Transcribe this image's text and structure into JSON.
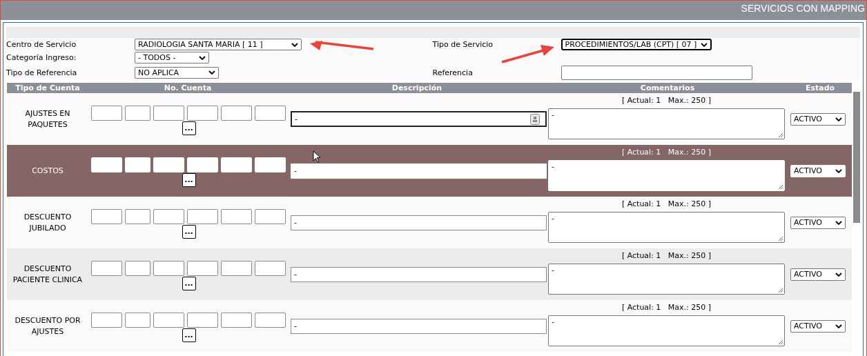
{
  "header": {
    "title": "SERVICIOS CON MAPPING"
  },
  "form_rows": [
    {
      "left": {
        "label": "Centro de Servicio",
        "kind": "select",
        "value": "RADIOLOGIA SANTA MARIA [ 11 ]",
        "focused": false
      },
      "right": {
        "label": "Tipo de Servicio",
        "kind": "select",
        "value": "PROCEDIMIENTOS/LAB (CPT) [ 07 ]",
        "focused": true
      }
    },
    {
      "left": {
        "label": "Categoría Ingreso:",
        "kind": "select",
        "value": "- TODOS -",
        "focused": false
      }
    },
    {
      "left": {
        "label": "Tipo de Referencia",
        "kind": "select",
        "value": "NO APLICA",
        "focused": false
      },
      "right": {
        "label": "Referencia",
        "kind": "input",
        "focused": false
      }
    }
  ],
  "table": {
    "columns": [
      "Tipo de Cuenta",
      "No. Cuenta",
      "Descripción",
      "Comentarios",
      "Estado"
    ],
    "lookup_button": "...",
    "rows": [
      {
        "account_type": "AJUSTES EN PAQUETES",
        "description": "-",
        "counter": "[ Actual: 1   Max.: 250 ]",
        "comment": "-",
        "status": "ACTIVO",
        "selected": false,
        "focused": true
      },
      {
        "account_type": "COSTOS",
        "description": "-",
        "counter": "[ Actual: 1   Max.: 250 ]",
        "comment": "-",
        "status": "ACTIVO",
        "selected": true,
        "focused": false
      },
      {
        "account_type": "DESCUENTO JUBILADO",
        "description": "-",
        "counter": "[ Actual: 1   Max.: 250 ]",
        "comment": "-",
        "status": "ACTIVO",
        "selected": false,
        "focused": false
      },
      {
        "account_type": "DESCUENTO PACIENTE CLINICA",
        "description": "-",
        "counter": "[ Actual: 1   Max.: 250 ]",
        "comment": "-",
        "status": "ACTIVO",
        "selected": false,
        "focused": false
      },
      {
        "account_type": "DESCUENTO POR AJUSTES",
        "description": "-",
        "counter": "[ Actual: 1   Max.: 250 ]",
        "comment": "-",
        "status": "ACTIVO",
        "selected": false,
        "focused": false
      }
    ]
  }
}
